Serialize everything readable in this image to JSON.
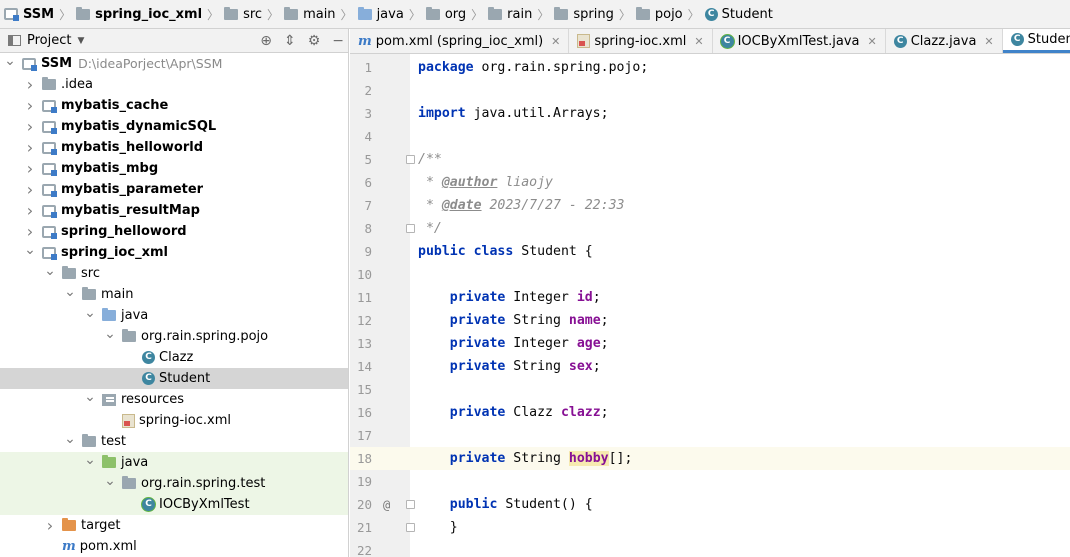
{
  "breadcrumbs": [
    {
      "label": "SSM",
      "icon": "module-icon",
      "bold": true
    },
    {
      "label": "spring_ioc_xml",
      "icon": "folder-icon",
      "bold": true
    },
    {
      "label": "src",
      "icon": "folder-icon",
      "bold": false
    },
    {
      "label": "main",
      "icon": "folder-icon",
      "bold": false
    },
    {
      "label": "java",
      "icon": "source-folder-icon",
      "bold": false
    },
    {
      "label": "org",
      "icon": "package-icon",
      "bold": false
    },
    {
      "label": "rain",
      "icon": "package-icon",
      "bold": false
    },
    {
      "label": "spring",
      "icon": "package-icon",
      "bold": false
    },
    {
      "label": "pojo",
      "icon": "package-icon",
      "bold": false
    },
    {
      "label": "Student",
      "icon": "class-icon",
      "bold": false
    }
  ],
  "project_panel": {
    "title": "Project",
    "tree": [
      {
        "label": "SSM",
        "path": "D:\\ideaPorject\\Apr\\SSM",
        "bold": true,
        "level": 0,
        "arrow": "down",
        "icon": "module"
      },
      {
        "label": ".idea",
        "bold": false,
        "level": 1,
        "arrow": "right",
        "icon": "folder"
      },
      {
        "label": "mybatis_cache",
        "bold": true,
        "level": 1,
        "arrow": "right",
        "icon": "module"
      },
      {
        "label": "mybatis_dynamicSQL",
        "bold": true,
        "level": 1,
        "arrow": "right",
        "icon": "module"
      },
      {
        "label": "mybatis_helloworld",
        "bold": true,
        "level": 1,
        "arrow": "right",
        "icon": "module"
      },
      {
        "label": "mybatis_mbg",
        "bold": true,
        "level": 1,
        "arrow": "right",
        "icon": "module"
      },
      {
        "label": "mybatis_parameter",
        "bold": true,
        "level": 1,
        "arrow": "right",
        "icon": "module"
      },
      {
        "label": "mybatis_resultMap",
        "bold": true,
        "level": 1,
        "arrow": "right",
        "icon": "module"
      },
      {
        "label": "spring_helloword",
        "bold": true,
        "level": 1,
        "arrow": "right",
        "icon": "module"
      },
      {
        "label": "spring_ioc_xml",
        "bold": true,
        "level": 1,
        "arrow": "down",
        "icon": "module"
      },
      {
        "label": "src",
        "bold": false,
        "level": 2,
        "arrow": "down",
        "icon": "folder"
      },
      {
        "label": "main",
        "bold": false,
        "level": 3,
        "arrow": "down",
        "icon": "folder"
      },
      {
        "label": "java",
        "bold": false,
        "level": 4,
        "arrow": "down",
        "icon": "source"
      },
      {
        "label": "org.rain.spring.pojo",
        "bold": false,
        "level": 5,
        "arrow": "down",
        "icon": "package"
      },
      {
        "label": "Clazz",
        "bold": false,
        "level": 6,
        "arrow": "none",
        "icon": "class"
      },
      {
        "label": "Student",
        "bold": false,
        "level": 6,
        "arrow": "none",
        "icon": "class",
        "selected": true
      },
      {
        "label": "resources",
        "bold": false,
        "level": 4,
        "arrow": "down",
        "icon": "resources"
      },
      {
        "label": "spring-ioc.xml",
        "bold": false,
        "level": 5,
        "arrow": "none",
        "icon": "xml"
      },
      {
        "label": "test",
        "bold": false,
        "level": 3,
        "arrow": "down",
        "icon": "folder"
      },
      {
        "label": "java",
        "bold": false,
        "level": 4,
        "arrow": "down",
        "icon": "test-source",
        "test": true
      },
      {
        "label": "org.rain.spring.test",
        "bold": false,
        "level": 5,
        "arrow": "down",
        "icon": "package",
        "test": true
      },
      {
        "label": "IOCByXmlTest",
        "bold": false,
        "level": 6,
        "arrow": "none",
        "icon": "test-class",
        "test": true
      },
      {
        "label": "target",
        "bold": false,
        "level": 2,
        "arrow": "right",
        "icon": "excluded"
      },
      {
        "label": "pom.xml",
        "bold": false,
        "level": 2,
        "arrow": "none",
        "icon": "maven"
      }
    ]
  },
  "tabs": [
    {
      "label": "pom.xml (spring_ioc_xml)",
      "icon": "maven",
      "active": false
    },
    {
      "label": "spring-ioc.xml",
      "icon": "xml",
      "active": false
    },
    {
      "label": "IOCByXmlTest.java",
      "icon": "test-class",
      "active": false
    },
    {
      "label": "Clazz.java",
      "icon": "class",
      "active": false
    },
    {
      "label": "Student.java",
      "icon": "class",
      "active": true
    }
  ],
  "editor": {
    "current_line": 18,
    "lines": [
      {
        "n": "1",
        "tokens": [
          [
            "kw",
            "package"
          ],
          [
            "",
            "org.rain.spring.pojo;"
          ]
        ]
      },
      {
        "n": "2",
        "tokens": []
      },
      {
        "n": "3",
        "tokens": [
          [
            "kw",
            "import"
          ],
          [
            "",
            "java.util.Arrays;"
          ]
        ]
      },
      {
        "n": "4",
        "tokens": []
      },
      {
        "n": "5",
        "fold": true,
        "tokens": [
          [
            "cm",
            "/**"
          ]
        ]
      },
      {
        "n": "6",
        "tokens": [
          [
            "cm",
            " * "
          ],
          [
            "tag",
            "@author"
          ],
          [
            "cm",
            " liaojy"
          ]
        ]
      },
      {
        "n": "7",
        "tokens": [
          [
            "cm",
            " * "
          ],
          [
            "tag",
            "@date"
          ],
          [
            "cm",
            " 2023/7/27 - 22:33"
          ]
        ]
      },
      {
        "n": "8",
        "fold": true,
        "tokens": [
          [
            "cm",
            " */"
          ]
        ]
      },
      {
        "n": "9",
        "tokens": [
          [
            "kw",
            "public"
          ],
          [
            "kw",
            "class"
          ],
          [
            "",
            "Student {"
          ]
        ]
      },
      {
        "n": "10",
        "tokens": []
      },
      {
        "n": "11",
        "tokens": [
          [
            "",
            "    "
          ],
          [
            "kw",
            "private"
          ],
          [
            "",
            "Integer "
          ],
          [
            "fld",
            "id"
          ],
          [
            "",
            ";"
          ]
        ]
      },
      {
        "n": "12",
        "tokens": [
          [
            "",
            "    "
          ],
          [
            "kw",
            "private"
          ],
          [
            "",
            "String "
          ],
          [
            "fld",
            "name"
          ],
          [
            "",
            ";"
          ]
        ]
      },
      {
        "n": "13",
        "tokens": [
          [
            "",
            "    "
          ],
          [
            "kw",
            "private"
          ],
          [
            "",
            "Integer "
          ],
          [
            "fld",
            "age"
          ],
          [
            "",
            ";"
          ]
        ]
      },
      {
        "n": "14",
        "tokens": [
          [
            "",
            "    "
          ],
          [
            "kw",
            "private"
          ],
          [
            "",
            "String "
          ],
          [
            "fld",
            "sex"
          ],
          [
            "",
            ";"
          ]
        ]
      },
      {
        "n": "15",
        "tokens": []
      },
      {
        "n": "16",
        "tokens": [
          [
            "",
            "    "
          ],
          [
            "kw",
            "private"
          ],
          [
            "",
            "Clazz "
          ],
          [
            "fld",
            "clazz"
          ],
          [
            "",
            ";"
          ]
        ]
      },
      {
        "n": "17",
        "tokens": []
      },
      {
        "n": "18",
        "tokens": [
          [
            "",
            "    "
          ],
          [
            "kw",
            "private"
          ],
          [
            "",
            "String "
          ],
          [
            "fldhl",
            "hobby"
          ],
          [
            "",
            "[];"
          ]
        ]
      },
      {
        "n": "19",
        "tokens": []
      },
      {
        "n": "20",
        "at": "@",
        "fold": true,
        "tokens": [
          [
            "",
            "    "
          ],
          [
            "kw",
            "public"
          ],
          [
            "",
            "Student() {"
          ]
        ]
      },
      {
        "n": "21",
        "fold": true,
        "tokens": [
          [
            "",
            "    }"
          ]
        ]
      },
      {
        "n": "22",
        "tokens": []
      }
    ]
  }
}
